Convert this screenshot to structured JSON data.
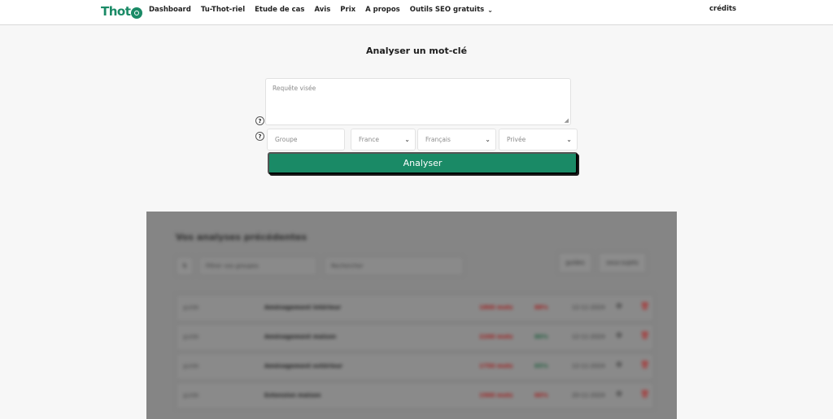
{
  "header": {
    "logo_text": "Thot",
    "nav": [
      {
        "label": "Dashboard"
      },
      {
        "label": "Tu-Thot-riel"
      },
      {
        "label": "Etude de cas"
      },
      {
        "label": "Avis"
      },
      {
        "label": "Prix"
      },
      {
        "label": "A propos"
      },
      {
        "label": "Outils SEO gratuits",
        "dropdown": true
      }
    ],
    "credits_label": "crédits"
  },
  "form": {
    "title": "Analyser un mot-clé",
    "query_placeholder": "Requête visée",
    "help_glyph": "?",
    "group_placeholder": "Groupe",
    "country": "France",
    "language": "Français",
    "visibility": "Privée",
    "submit_label": "Analyser"
  },
  "previous": {
    "title": "Vos analyses précédentes",
    "filter_placeholder": "Filtrer vos groupes",
    "search_placeholder": "Rechercher",
    "button_1": "guides",
    "button_2": "sous-sujets",
    "rows": [
      {
        "group": "guide",
        "keyword": "Aménagement intérieur",
        "volume": "1800 mots",
        "score": "88%",
        "date": "12-11-2024"
      },
      {
        "group": "guide",
        "keyword": "Aménagement maison",
        "volume": "2200 mots",
        "score": "80%",
        "date": "12-11-2024"
      },
      {
        "group": "guide",
        "keyword": "Aménagement extérieur",
        "volume": "1750 mots",
        "score": "65%",
        "date": "12-11-2024"
      },
      {
        "group": "guide",
        "keyword": "Extension maison",
        "volume": "1900 mots",
        "score": "60%",
        "date": "20-11-2024"
      }
    ]
  },
  "colors": {
    "brand_green": "#1a8a66",
    "panel_gray": "#858585",
    "negative": "#a01b1b"
  }
}
